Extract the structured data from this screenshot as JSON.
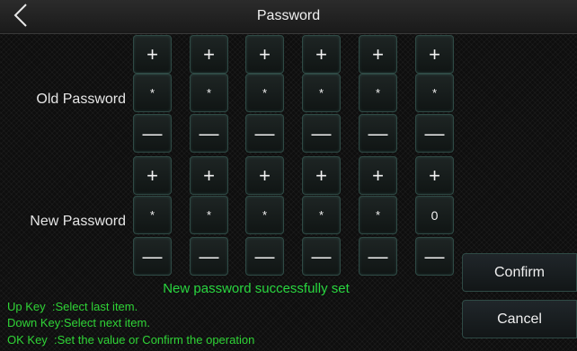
{
  "header": {
    "title": "Password",
    "back_icon": "chevron-left-icon"
  },
  "old_password": {
    "label": "Old Password",
    "plus": [
      "+",
      "+",
      "+",
      "+",
      "+",
      "+"
    ],
    "digits": [
      "*",
      "*",
      "*",
      "*",
      "*",
      "*"
    ],
    "minus": [
      "—",
      "—",
      "—",
      "—",
      "—",
      "—"
    ]
  },
  "new_password": {
    "label": "New Password",
    "plus": [
      "+",
      "+",
      "+",
      "+",
      "+",
      "+"
    ],
    "digits": [
      "*",
      "*",
      "*",
      "*",
      "*",
      "0"
    ],
    "minus": [
      "—",
      "—",
      "—",
      "—",
      "—",
      "—"
    ]
  },
  "actions": {
    "confirm": "Confirm",
    "cancel": "Cancel"
  },
  "status": {
    "message": "New password successfully set",
    "color": "#29d63f"
  },
  "help": {
    "up": "Up Key  :Select last item.",
    "down": "Down Key:Select next item.",
    "ok": "OK Key  :Set the value or Confirm the operation",
    "color": "#2fd436"
  }
}
